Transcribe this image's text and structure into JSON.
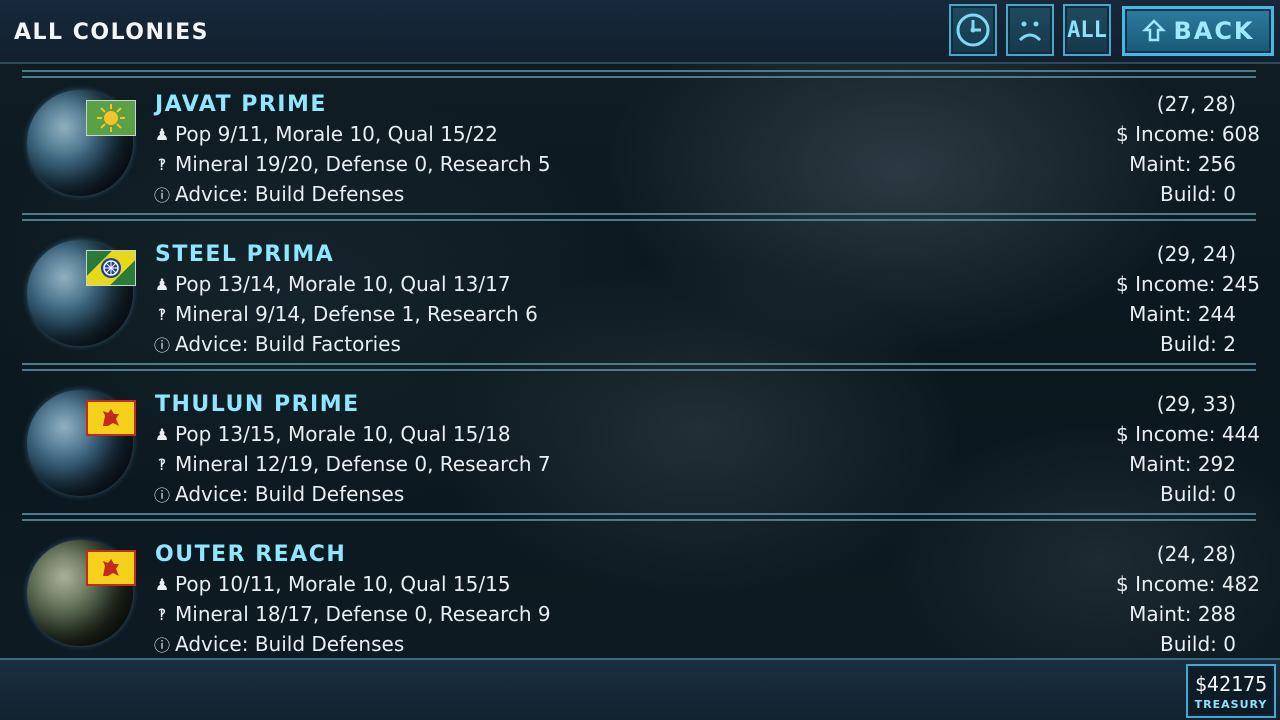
{
  "header": {
    "title": "ALL COLONIES",
    "buttons": {
      "timer_icon": "clock-icon",
      "unhappy_icon": "frown-face-icon",
      "all_label": "ALL",
      "back_label": "BACK"
    }
  },
  "colonies": [
    {
      "name": "JAVAT PRIME",
      "coords": "(27, 28)",
      "pop": "Pop 9/11, Morale 10, Qual 15/22",
      "stats": "Mineral 19/20, Defense 0, Research 5",
      "advice": "Advice: Build Defenses",
      "income": "Income: 608",
      "maint": "Maint: 256",
      "build": "Build: 0",
      "flag": "sun-flag",
      "planet": "blue"
    },
    {
      "name": "STEEL PRIMA",
      "coords": "(29, 24)",
      "pop": "Pop 13/14, Morale 10, Qual 13/17",
      "stats": "Mineral 9/14, Defense 1, Research 6",
      "advice": "Advice: Build Factories",
      "income": "Income: 245",
      "maint": "Maint: 244",
      "build": "Build: 2",
      "flag": "wheel-flag",
      "planet": "blue"
    },
    {
      "name": "THULUN PRIME",
      "coords": "(29, 33)",
      "pop": "Pop 13/15, Morale 10, Qual 15/18",
      "stats": "Mineral 12/19, Defense 0, Research 7",
      "advice": "Advice: Build Defenses",
      "income": "Income: 444",
      "maint": "Maint: 292",
      "build": "Build: 0",
      "flag": "lion-flag",
      "planet": "blue"
    },
    {
      "name": "OUTER REACH",
      "coords": "(24, 28)",
      "pop": "Pop 10/11, Morale 10, Qual 15/15",
      "stats": "Mineral 18/17, Defense 0, Research 9",
      "advice": "Advice: Build Defenses",
      "income": "Income: 482",
      "maint": "Maint: 288",
      "build": "Build: 0",
      "flag": "lion-flag",
      "planet": "green"
    }
  ],
  "footer": {
    "treasury_amount": "$42175",
    "treasury_label": "TREASURY"
  },
  "colors": {
    "accent": "#49a6c8",
    "name_text": "#8fe6ff",
    "header_bg": "#16283a"
  }
}
